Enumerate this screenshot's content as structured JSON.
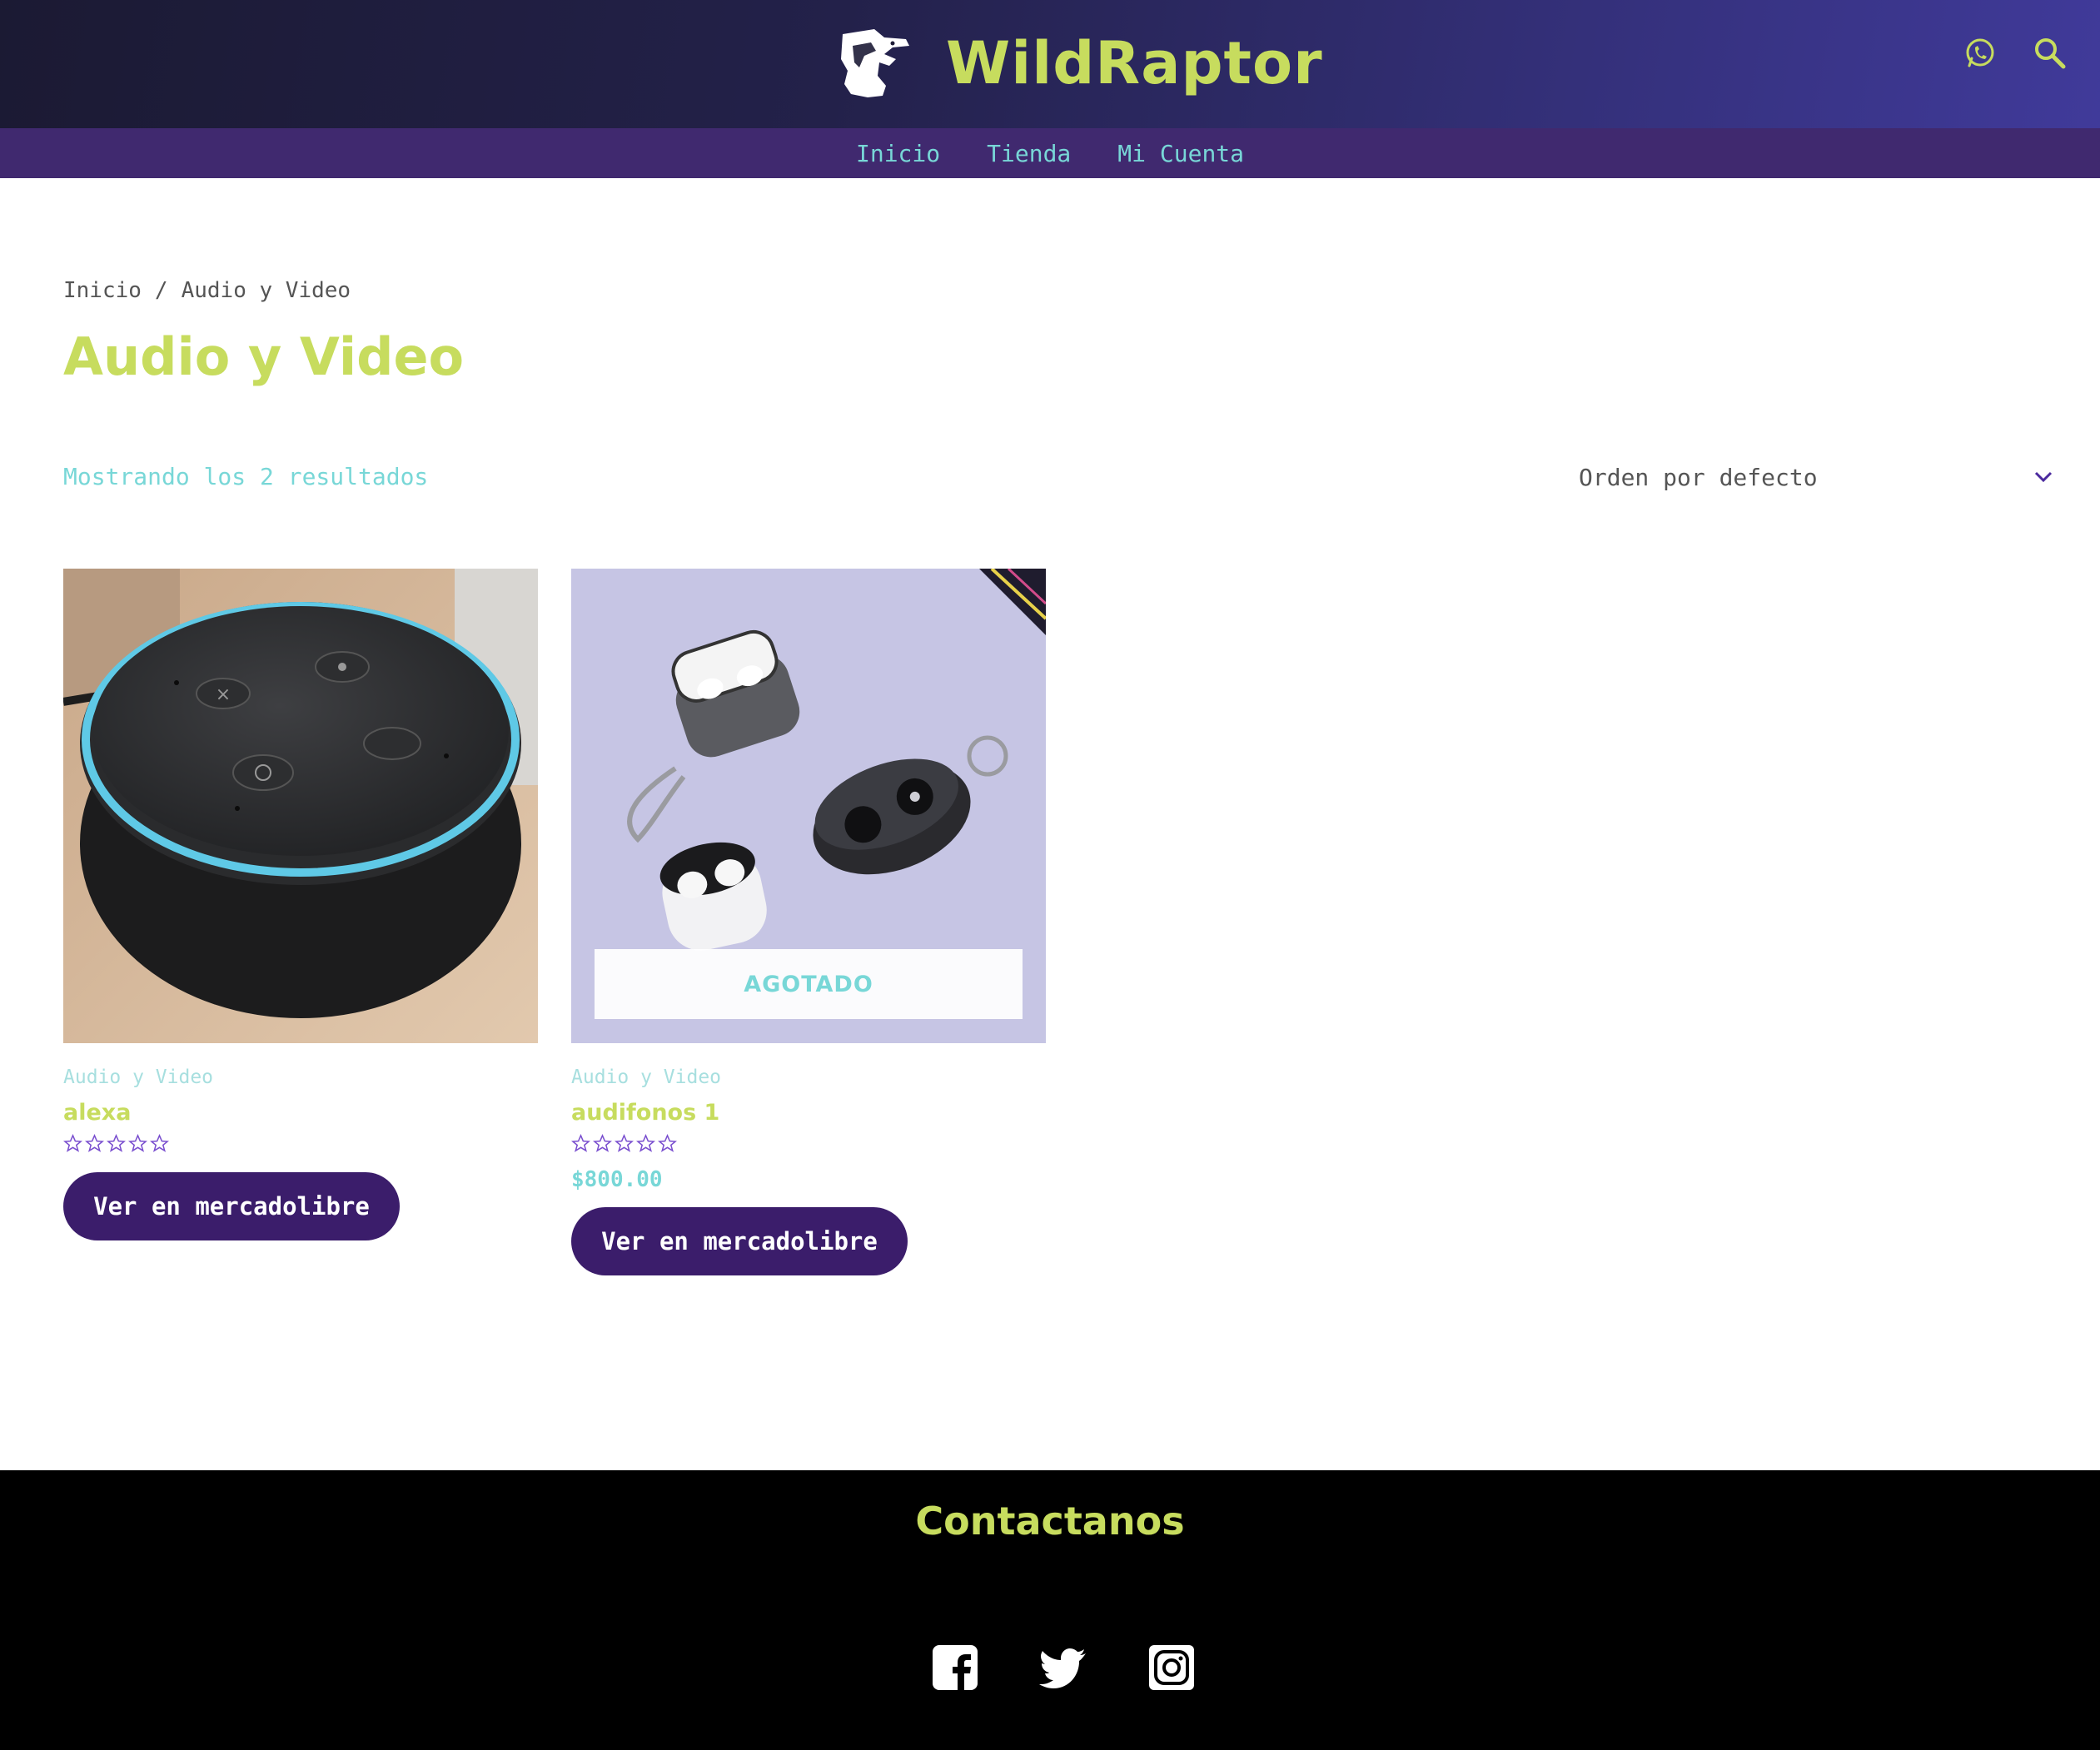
{
  "header": {
    "brand_name": "WildRaptor",
    "icons": [
      "whatsapp-icon",
      "search-icon"
    ]
  },
  "nav": {
    "items": [
      "Inicio",
      "Tienda",
      "Mi Cuenta"
    ]
  },
  "breadcrumb": {
    "home": "Inicio",
    "separator": "/",
    "current": "Audio y Video"
  },
  "page": {
    "title": "Audio y Video",
    "result_count": "Mostrando los 2 resultados",
    "ordering": "Orden por defecto"
  },
  "products": [
    {
      "category": "Audio y Video",
      "title": "alexa",
      "rating": 0,
      "price": "",
      "button_label": "Ver en mercadolibre",
      "badge": ""
    },
    {
      "category": "Audio y Video",
      "title": "audifonos 1",
      "rating": 0,
      "price": "$800.00",
      "button_label": "Ver en mercadolibre",
      "badge": "AGOTADO"
    }
  ],
  "footer": {
    "title": "Contactanos",
    "social_icons": [
      "facebook-icon",
      "twitter-icon",
      "instagram-icon"
    ]
  },
  "colors": {
    "brand_lime": "#c7dc5e",
    "accent_teal": "#78d7d7",
    "nav_purple": "#40296f",
    "button_purple": "#3b1d6b"
  }
}
